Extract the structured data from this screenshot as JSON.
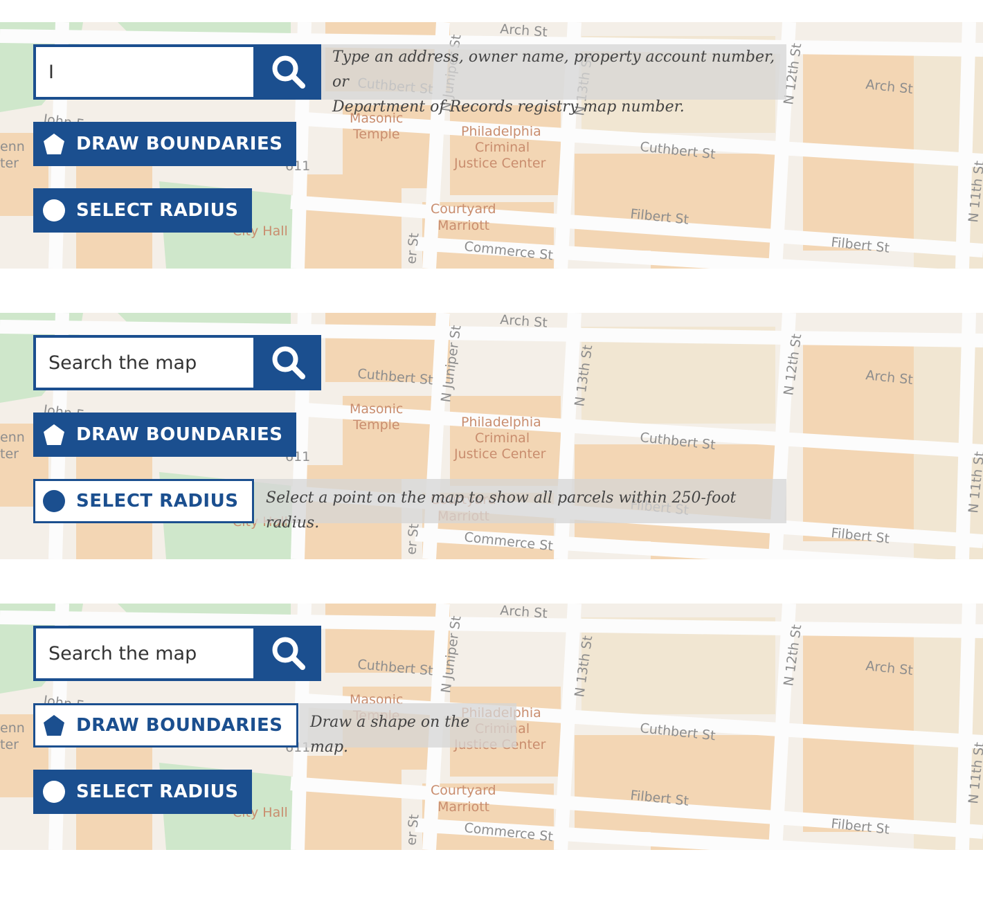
{
  "colors": {
    "accent": "#1b4f8f",
    "map_building": "#f3d6b4",
    "map_park": "#cde6c9",
    "map_street": "#fbfbfb"
  },
  "map_labels": {
    "arch_st_top": "Arch St",
    "arch_st_right": "Arch St",
    "cuthbert_st": "Cuthbert St",
    "cuthbert_st_left": "Cuthbert St",
    "filbert_st": "Filbert St",
    "filbert_st_right": "Filbert St",
    "commerce_st": "Commerce St",
    "n_12th_st": "N 12th St",
    "n_13th_st": "N 13th St",
    "n_11th_st": "N 11th St",
    "n_juniper_st": "N Juniper St",
    "masonic_temple_1": "Masonic",
    "masonic_temple_2": "Temple",
    "philadelphia_1": "Philadelphia",
    "philadelphia_2": "Criminal",
    "philadelphia_3": "Justice Center",
    "courtyard_1": "Courtyard",
    "courtyard_2": "Marriott",
    "city_hall": "City Hall",
    "john_f": "John F",
    "penn": "enn",
    "center": "ter",
    "route": "611"
  },
  "panels": [
    {
      "search": {
        "value": "I",
        "placeholder": "Search the map",
        "icon": "search-icon"
      },
      "search_hint": {
        "line1": "Type an address, owner name, property account number, or",
        "line2": "Department of Records registry map number."
      },
      "draw_boundaries": {
        "label": "DRAW BOUNDARIES",
        "icon": "pentagon-icon"
      },
      "select_radius": {
        "label": "SELECT RADIUS",
        "icon": "circle-icon"
      }
    },
    {
      "search": {
        "value": "",
        "placeholder": "Search the map",
        "icon": "search-icon"
      },
      "draw_boundaries": {
        "label": "DRAW BOUNDARIES",
        "icon": "pentagon-icon"
      },
      "select_radius": {
        "label": "SELECT RADIUS",
        "icon": "circle-icon",
        "hint": "Select a point on the map to show all parcels within 250-foot radius."
      }
    },
    {
      "search": {
        "value": "",
        "placeholder": "Search the map",
        "icon": "search-icon"
      },
      "draw_boundaries": {
        "label": "DRAW BOUNDARIES",
        "icon": "pentagon-icon",
        "hint": "Draw a shape on the map."
      },
      "select_radius": {
        "label": "SELECT RADIUS",
        "icon": "circle-icon"
      }
    }
  ]
}
